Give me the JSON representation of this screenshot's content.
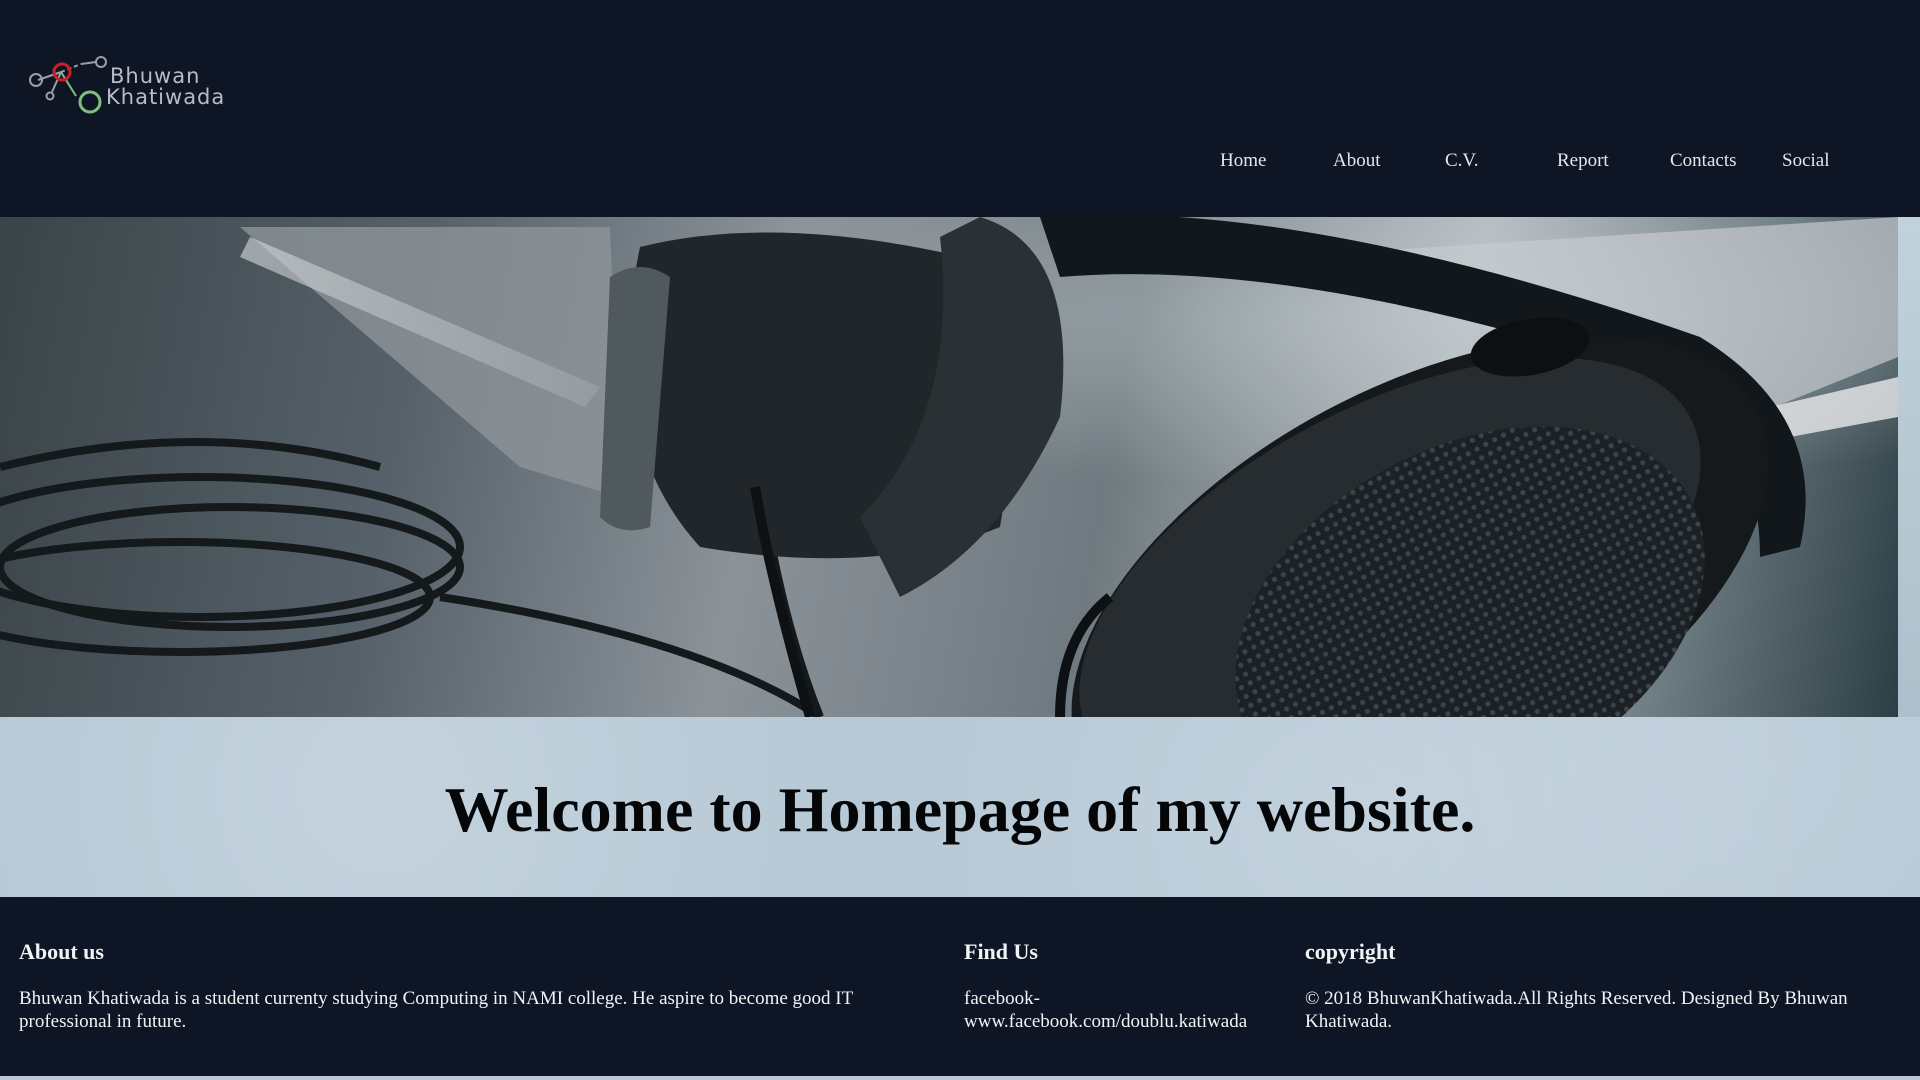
{
  "logo": {
    "line1": "Bhuwan",
    "line2": "Khatiwada",
    "icon": "molecule-logo-icon"
  },
  "nav": {
    "items": [
      {
        "label": "Home"
      },
      {
        "label": "About"
      },
      {
        "label": "C.V."
      },
      {
        "label": "Report"
      },
      {
        "label": "Contacts"
      },
      {
        "label": "Social"
      }
    ]
  },
  "hero": {
    "image": "headphones-photo"
  },
  "welcome": {
    "title": "Welcome to Homepage of my website."
  },
  "footer": {
    "about": {
      "heading": "About us",
      "text": "Bhuwan Khatiwada is a student currenty studying Computing in NAMI college. He aspire to become good IT professional in future."
    },
    "find": {
      "heading": "Find Us",
      "line1": "facebook-",
      "line2": "www.facebook.com/doublu.katiwada"
    },
    "copyright": {
      "heading": "copyright",
      "text": "© 2018 BhuwanKhatiwada.All Rights Reserved. Designed By Bhuwan Khatiwada."
    }
  },
  "colors": {
    "header_bg": "#0e1626",
    "welcome_bg": "#b7c9d6",
    "logo_accent_red": "#c8202a",
    "logo_accent_green": "#7fc07f"
  }
}
